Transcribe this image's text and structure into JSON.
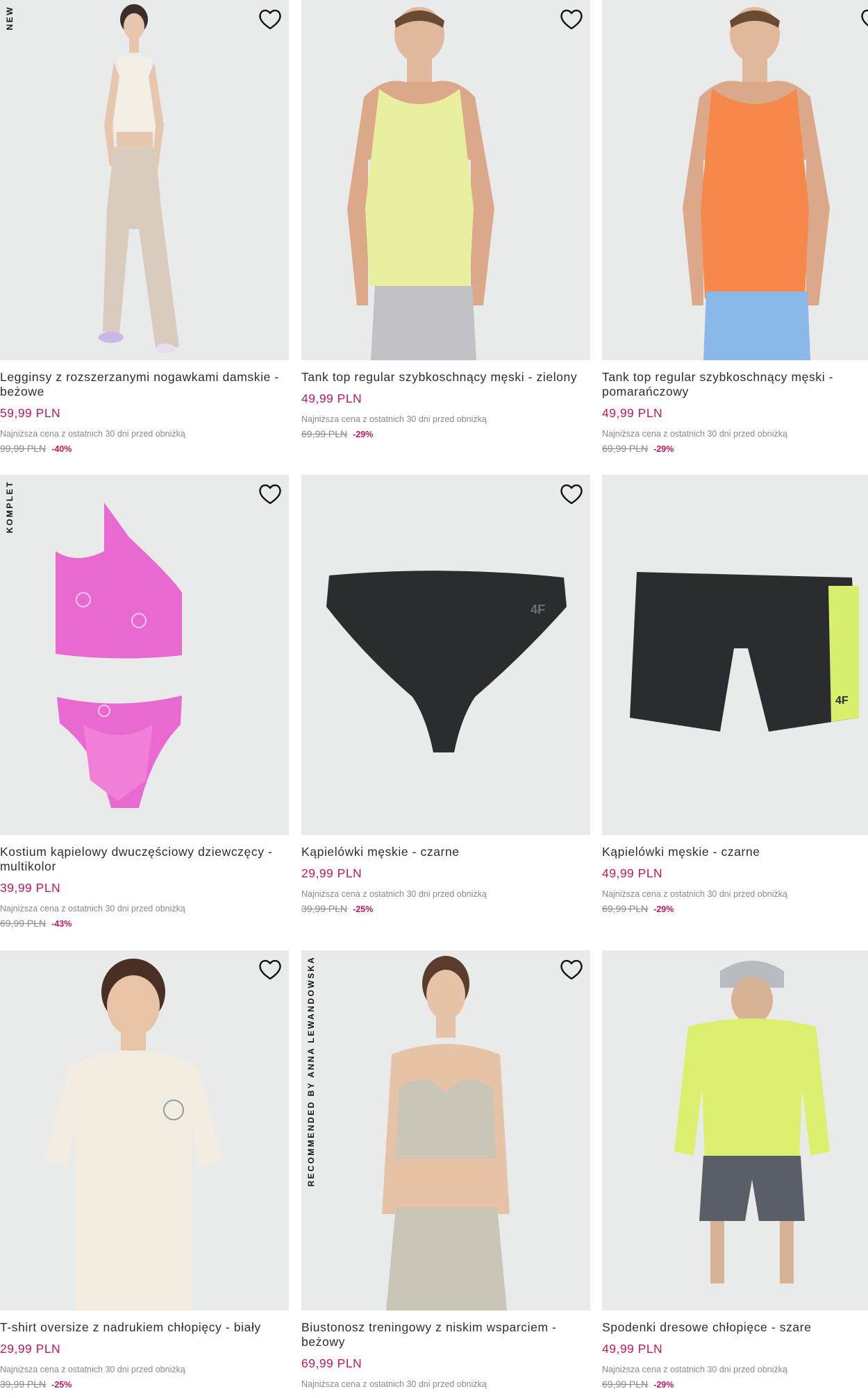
{
  "products": [
    {
      "badge": "NEW",
      "title": "Legginsy z rozszerzanymi nogawkami damskie - beżowe",
      "price": "59,99 PLN",
      "lowest_label": "Najniższa cena z ostatnich 30 dni przed obniżką",
      "old_price": "99,99 PLN",
      "discount": "-40%"
    },
    {
      "badge": "",
      "title": "Tank top regular szybkoschnący męski - zielony",
      "price": "49,99 PLN",
      "lowest_label": "Najniższa cena z ostatnich 30 dni przed obniżką",
      "old_price": "69,99 PLN",
      "discount": "-29%"
    },
    {
      "badge": "",
      "title": "Tank top regular szybkoschnący męski - pomarańczowy",
      "price": "49,99 PLN",
      "lowest_label": "Najniższa cena z ostatnich 30 dni przed obniżką",
      "old_price": "69,99 PLN",
      "discount": "-29%"
    },
    {
      "badge": "KOMPLET",
      "title": "Kostium kąpielowy dwuczęściowy dziewczęcy - multikolor",
      "price": "39,99 PLN",
      "lowest_label": "Najniższa cena z ostatnich 30 dni przed obniżką",
      "old_price": "69,99 PLN",
      "discount": "-43%"
    },
    {
      "badge": "",
      "title": "Kąpielówki męskie - czarne",
      "price": "29,99 PLN",
      "lowest_label": "Najniższa cena z ostatnich 30 dni przed obniżką",
      "old_price": "39,99 PLN",
      "discount": "-25%"
    },
    {
      "badge": "",
      "title": "Kąpielówki męskie - czarne",
      "price": "49,99 PLN",
      "lowest_label": "Najniższa cena z ostatnich 30 dni przed obniżką",
      "old_price": "69,99 PLN",
      "discount": "-29%"
    },
    {
      "badge": "",
      "title": "T-shirt oversize z nadrukiem chłopięcy - biały",
      "price": "29,99 PLN",
      "lowest_label": "Najniższa cena z ostatnich 30 dni przed obniżką",
      "old_price": "39,99 PLN",
      "discount": "-25%"
    },
    {
      "badge": "RECOMMENDED BY ANNA LEWANDOWSKA",
      "title": "Biustonosz treningowy z niskim wsparciem - beżowy",
      "price": "69,99 PLN",
      "lowest_label": "Najniższa cena z ostatnich 30 dni przed obniżką",
      "old_price": "",
      "discount": ""
    },
    {
      "badge": "",
      "title": "Spodenki dresowe chłopięce - szare",
      "price": "49,99 PLN",
      "lowest_label": "Najniższa cena z ostatnich 30 dni przed obniżką",
      "old_price": "69,99 PLN",
      "discount": "-29%"
    }
  ],
  "icons": {
    "wishlist": "heart-outline-icon"
  },
  "colors": {
    "price": "#c2185b",
    "image_bg": "#e9eaea",
    "muted": "#8a8a8a"
  }
}
